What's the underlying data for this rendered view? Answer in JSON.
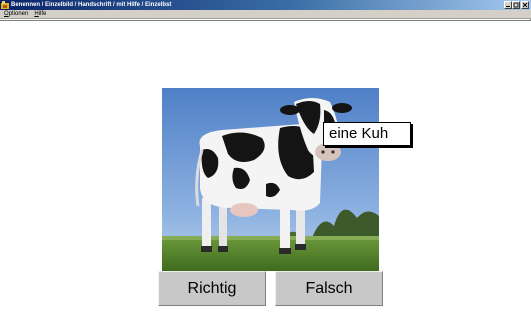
{
  "window": {
    "title": "Benennen / Einzelbild / Handschrift / mit Hilfe / Einzelbst",
    "controls": [
      "minimize-icon",
      "maximize-icon",
      "close-icon"
    ]
  },
  "menu": {
    "items": [
      {
        "underlined": "O",
        "rest": "ptionen"
      },
      {
        "underlined": "H",
        "rest": "ilfe"
      }
    ]
  },
  "picture": {
    "label": "eine Kuh"
  },
  "buttons": {
    "correct": "Richtig",
    "wrong": "Falsch"
  }
}
